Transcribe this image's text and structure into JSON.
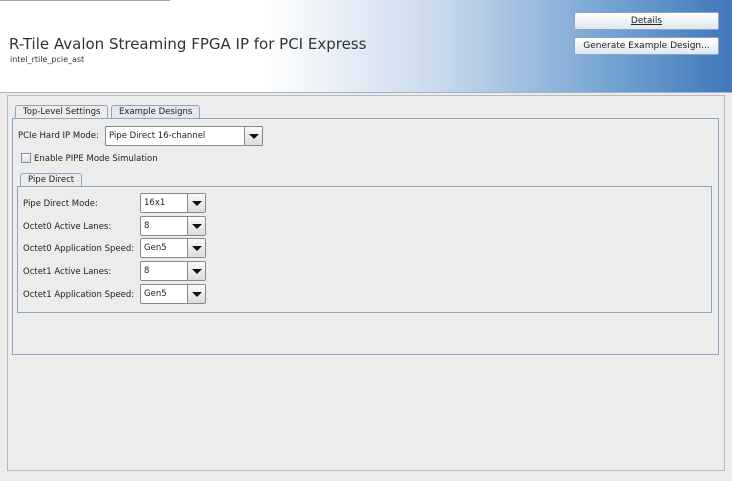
{
  "header": {
    "title": "R-Tile Avalon Streaming FPGA IP for PCI Express",
    "subtitle": "intel_rtile_pcie_ast",
    "details_button_label": "Details",
    "generate_button_label": "Generate Example Design..."
  },
  "tabs": [
    {
      "label": "Top-Level Settings",
      "active": true
    },
    {
      "label": "Example Designs",
      "active": false
    }
  ],
  "top_level": {
    "hard_ip_mode_label": "PCIe Hard IP Mode:",
    "hard_ip_mode_value": "Pipe Direct 16-channel",
    "pipe_sim_label": "Enable PIPE Mode Simulation",
    "pipe_sim_checked": false
  },
  "pipe_direct": {
    "tab_label": "Pipe Direct",
    "fields": [
      {
        "label": "Pipe Direct Mode:",
        "value": "16x1"
      },
      {
        "label": "Octet0 Active Lanes:",
        "value": "8"
      },
      {
        "label": "Octet0 Application Speed:",
        "value": "Gen5"
      },
      {
        "label": "Octet1 Active Lanes:",
        "value": "8"
      },
      {
        "label": "Octet1 Application Speed:",
        "value": "Gen5"
      }
    ]
  },
  "colors": {
    "accent": "#3f77b9",
    "border": "#8ea5c2"
  }
}
